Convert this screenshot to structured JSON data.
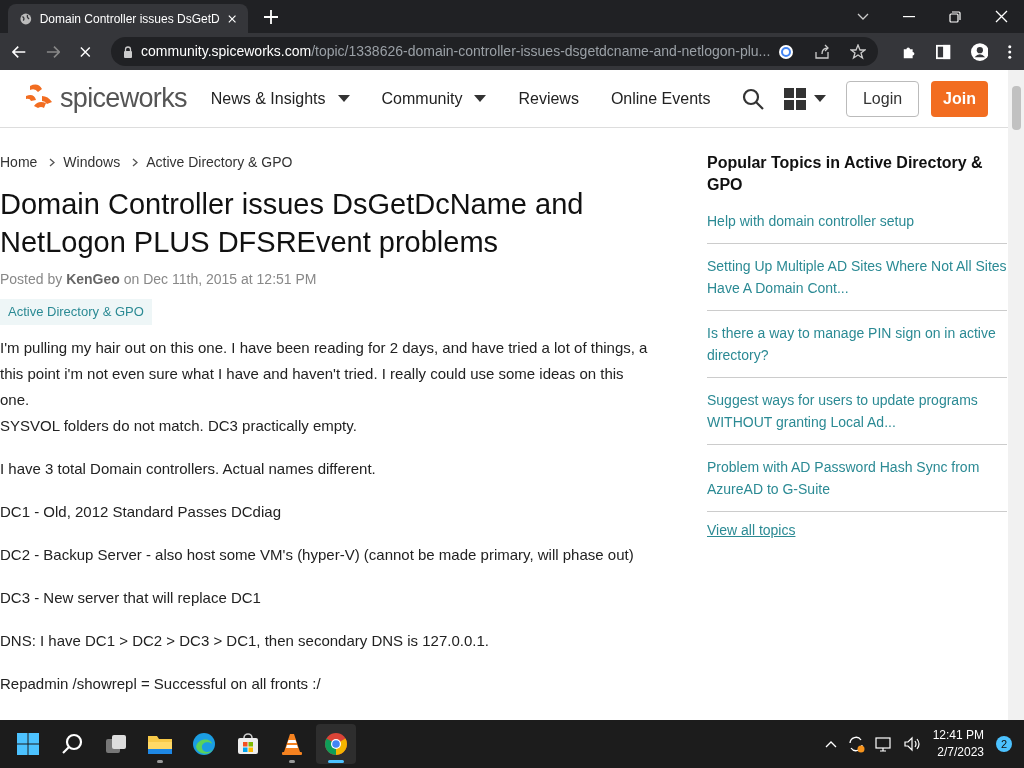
{
  "browser": {
    "tab_title": "Domain Controller issues DsGetD",
    "url_host": "community.spiceworks.com",
    "url_path": "/topic/1338626-domain-controller-issues-dsgetdcname-and-netlogon-plu..."
  },
  "site": {
    "logo": "spiceworks",
    "nav": [
      {
        "label": "News & Insights",
        "dropdown": true
      },
      {
        "label": "Community",
        "dropdown": true
      },
      {
        "label": "Reviews",
        "dropdown": false
      },
      {
        "label": "Online Events",
        "dropdown": false
      }
    ],
    "login": "Login",
    "join": "Join"
  },
  "breadcrumbs": [
    "Home",
    "Windows",
    "Active Directory & GPO"
  ],
  "title": "Domain Controller issues DsGetDcName and NetLogon PLUS DFSREvent problems",
  "posted": "Posted by **KenGeo** on Dec 11th, 2015 at 12:51 PM",
  "tag": "Active Directory & GPO",
  "paragraphs": [
    {
      "lines": [
        "I'm pulling my hair out on this one.  I have been reading for 2 days, and have tried a lot of things, a this point i'm not even sure what I have and haven't tried.  I really could use some ideas on this one.",
        "SYSVOL folders do not match.  DC3 practically empty."
      ]
    },
    {
      "lines": [
        "I have 3 total Domain controllers.  Actual names different."
      ]
    },
    {
      "lines": [
        "DC1 - Old, 2012 Standard Passes DCdiag"
      ]
    },
    {
      "lines": [
        "DC2 - Backup Server - also host some VM's (hyper-V) (cannot be made primary, will phase out)"
      ]
    },
    {
      "lines": [
        "DC3 - New server that will replace DC1"
      ]
    },
    {
      "lines": [
        "DNS: I have DC1 > DC2 > DC3 > DC1, then secondary DNS is 127.0.0.1."
      ]
    },
    {
      "lines": [
        "Repadmin /showrepl = Successful on all fronts :/"
      ]
    }
  ],
  "sidebar": {
    "title": "Popular Topics in Active Directory & GPO",
    "topics": [
      "Help with domain controller setup",
      "Setting Up Multiple AD Sites Where Not All Sites Have A Domain Cont...",
      "Is there a way to manage PIN sign on in active directory?",
      "Suggest ways for users to update programs WITHOUT granting Local Ad...",
      "Problem with AD Password Hash Sync from AzureAD to G-Suite"
    ],
    "view_all": "View all topics"
  },
  "taskbar": {
    "apps": [
      {
        "kind": "start",
        "running": false,
        "active": false
      },
      {
        "kind": "search",
        "running": false,
        "active": false
      },
      {
        "kind": "taskview",
        "running": false,
        "active": false
      },
      {
        "kind": "files",
        "running": true,
        "active": false
      },
      {
        "kind": "edge",
        "running": false,
        "active": false
      },
      {
        "kind": "store",
        "running": false,
        "active": false
      },
      {
        "kind": "vlc",
        "running": true,
        "active": false
      },
      {
        "kind": "chrome",
        "running": true,
        "active": true
      }
    ],
    "time": "12:41 PM",
    "date": "2/7/2023",
    "notifications": "2"
  }
}
